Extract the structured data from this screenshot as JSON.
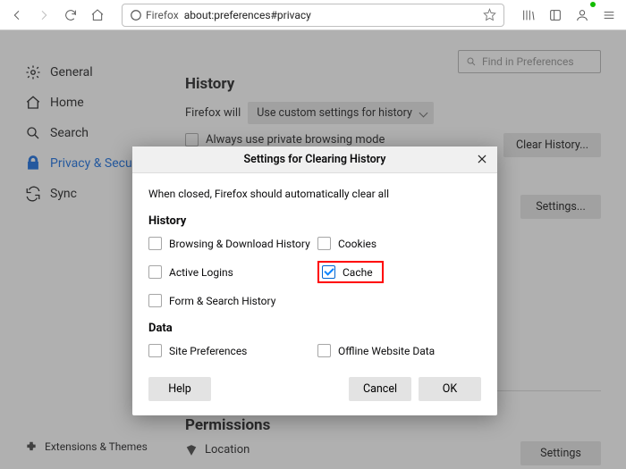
{
  "toolbar": {
    "browser_name": "Firefox",
    "url": "about:preferences#privacy"
  },
  "sidebar": {
    "items": [
      {
        "label": "General"
      },
      {
        "label": "Home"
      },
      {
        "label": "Search"
      },
      {
        "label": "Privacy & Security"
      },
      {
        "label": "Sync"
      }
    ],
    "bottom": {
      "label": "Extensions & Themes"
    }
  },
  "prefs": {
    "search_placeholder": "Find in Preferences",
    "history_heading": "History",
    "will_label": "Firefox will",
    "history_mode": "Use custom settings for history",
    "always_private": "Always use private browsing mode",
    "clear_history_btn": "Clear History...",
    "settings_btn": "Settings...",
    "settings_btn2": "Settings",
    "permissions_heading": "Permissions",
    "location_label": "Location"
  },
  "dialog": {
    "title": "Settings for Clearing History",
    "desc": "When closed, Firefox should automatically clear all",
    "history_heading": "History",
    "data_heading": "Data",
    "opts": {
      "browsing": "Browsing & Download History",
      "cookies": "Cookies",
      "active": "Active Logins",
      "cache": "Cache",
      "form": "Form & Search History",
      "siteprefs": "Site Preferences",
      "offline": "Offline Website Data"
    },
    "help": "Help",
    "cancel": "Cancel",
    "ok": "OK"
  }
}
